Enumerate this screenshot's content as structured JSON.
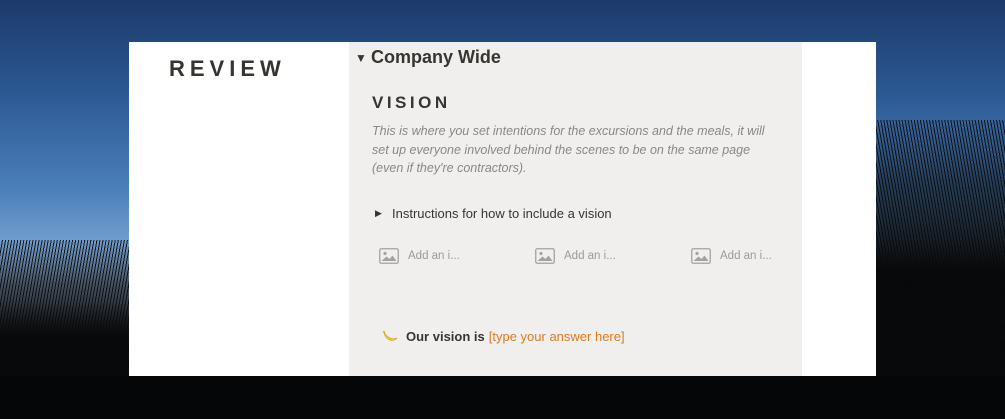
{
  "page": {
    "review_title": "REVIEW"
  },
  "panel": {
    "toggle": {
      "title": "Company Wide",
      "icon": "triangle-down-icon"
    },
    "vision": {
      "title": "VISION",
      "description": "This is where you set intentions for the excursions and the meals, it will set up everyone involved behind the scenes to be on the same page (even if they're contractors)."
    },
    "instructions_toggle": {
      "label": "Instructions for how to include a vision",
      "icon": "triangle-right-icon"
    },
    "image_slots": [
      {
        "label": "Add an i...",
        "icon": "image-icon"
      },
      {
        "label": "Add an i...",
        "icon": "image-icon"
      },
      {
        "label": "Add an i...",
        "icon": "image-icon"
      }
    ],
    "callout": {
      "icon": "crescent-moon-icon",
      "label": "Our vision is",
      "answer": "[type your answer here]"
    }
  },
  "colors": {
    "page_bg": "#ffffff",
    "panel_bg": "#f0efed",
    "text": "#37352f",
    "muted_text": "#8a8883",
    "answer_accent": "#e07b1a",
    "moon_accent": "#f2c94c"
  }
}
